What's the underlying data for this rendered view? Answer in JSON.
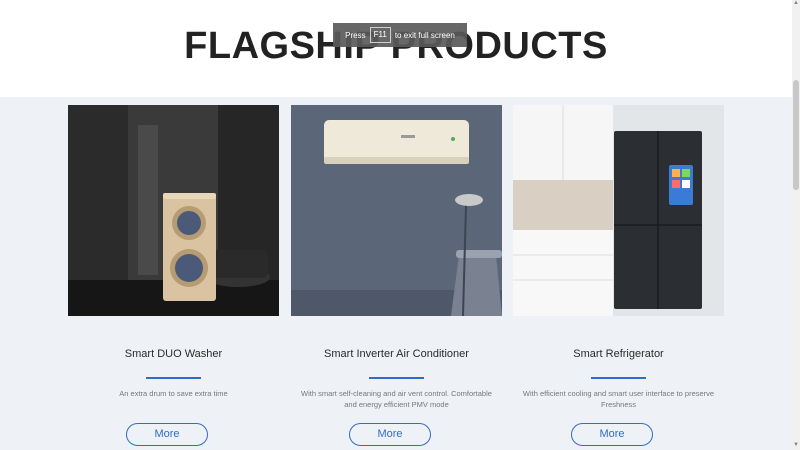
{
  "header": {
    "title": "FLAGSHIP PRODUCTS"
  },
  "fullscreen_toast": {
    "prefix": "Press",
    "key": "F11",
    "suffix": "to exit full screen"
  },
  "products": [
    {
      "name": "Smart DUO Washer",
      "description": "An extra drum to save extra time",
      "button": "More"
    },
    {
      "name": "Smart Inverter Air Conditioner",
      "description": "With smart self-cleaning and air vent control. Comfortable and energy efficient PMV mode",
      "button": "More"
    },
    {
      "name": "Smart Refrigerator",
      "description": "With efficient cooling and smart user interface to preserve Freshness",
      "button": "More"
    }
  ],
  "colors": {
    "accent": "#2e6dc8",
    "title": "#222222",
    "background": "#eef2f6"
  }
}
